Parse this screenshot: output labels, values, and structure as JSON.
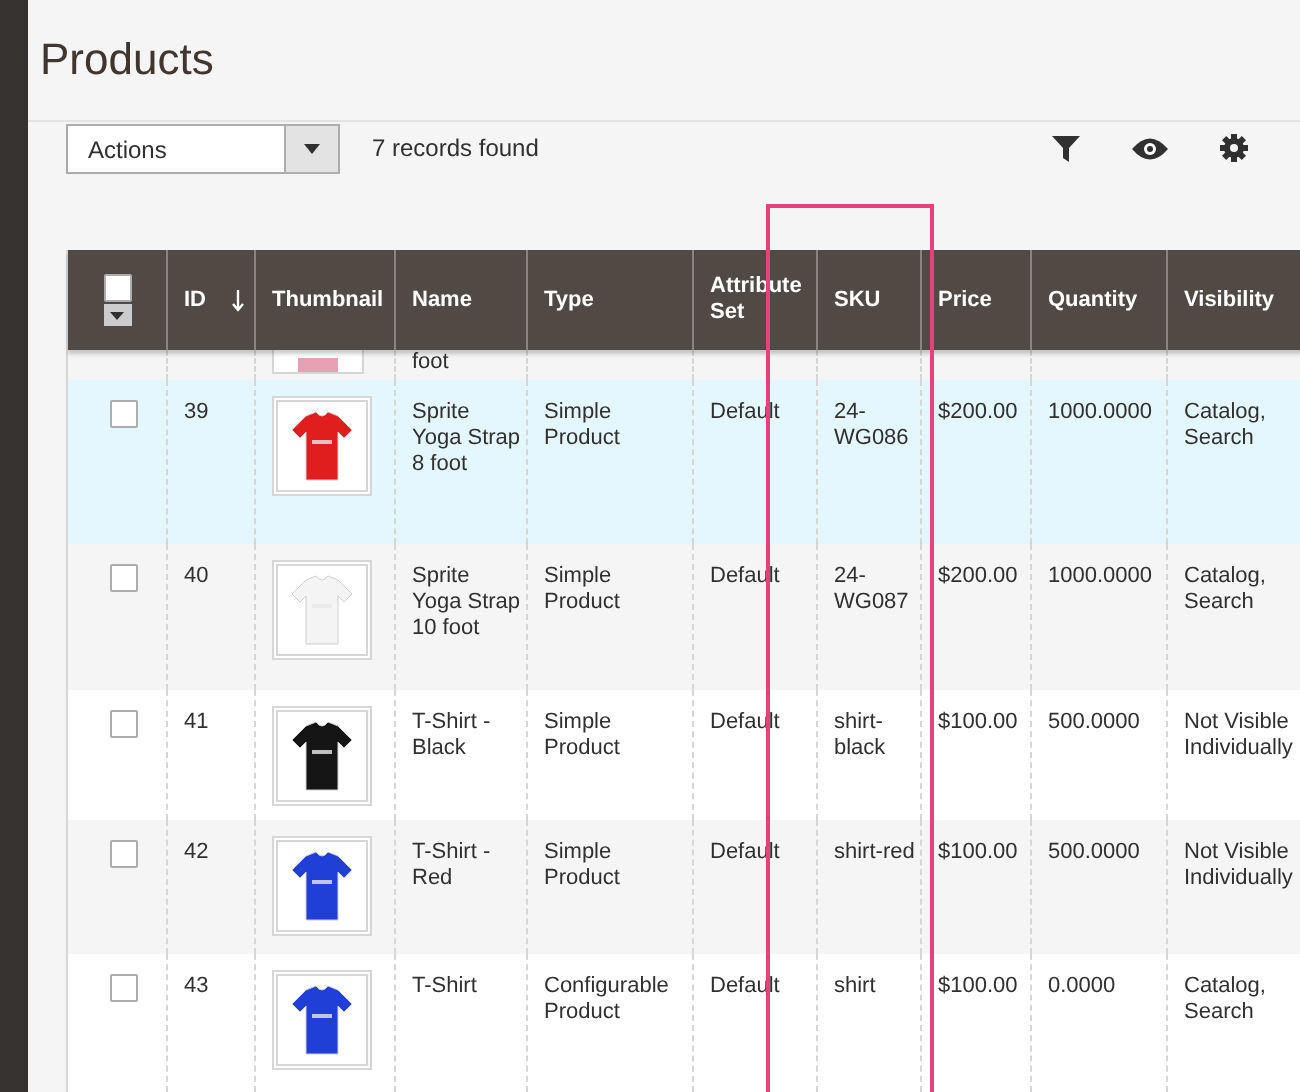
{
  "page": {
    "title": "Products"
  },
  "toolbar": {
    "actions": {
      "label": "Actions"
    },
    "records": "7 records found"
  },
  "table": {
    "select_all": {
      "checked": false
    },
    "columns": [
      {
        "label": "ID",
        "sorted": true
      },
      {
        "label": "Thumbnail",
        "sorted": false
      },
      {
        "label": "Name",
        "sorted": false
      },
      {
        "label": "Type",
        "sorted": false
      },
      {
        "label": "Attribute Set",
        "sorted": false
      },
      {
        "label": "SKU",
        "sorted": false
      },
      {
        "label": "Price",
        "sorted": false
      },
      {
        "label": "Quantity",
        "sorted": false
      },
      {
        "label": "Visibility",
        "sorted": false
      }
    ],
    "partial_row": {
      "name": "foot"
    },
    "rows": [
      {
        "checked": false,
        "highlighted": true,
        "id": "39",
        "name": "Sprite Yoga Strap 8 foot",
        "type": "Simple Product",
        "attribute_set": "Default",
        "sku": "24-WG086",
        "price": "$200.00",
        "quantity": "1000.0000",
        "visibility": "Catalog, Search"
      },
      {
        "checked": false,
        "highlighted": false,
        "id": "40",
        "name": "Sprite Yoga Strap 10 foot",
        "type": "Simple Product",
        "attribute_set": "Default",
        "sku": "24-WG087",
        "price": "$200.00",
        "quantity": "1000.0000",
        "visibility": "Catalog, Search"
      },
      {
        "checked": false,
        "highlighted": false,
        "id": "41",
        "name": "T-Shirt - Black",
        "type": "Simple Product",
        "attribute_set": "Default",
        "sku": "shirt-black",
        "price": "$100.00",
        "quantity": "500.0000",
        "visibility": "Not Visible Individually"
      },
      {
        "checked": false,
        "highlighted": false,
        "id": "42",
        "name": "T-Shirt - Red",
        "type": "Simple Product",
        "attribute_set": "Default",
        "sku": "shirt-red",
        "price": "$100.00",
        "quantity": "500.0000",
        "visibility": "Not Visible Individually"
      },
      {
        "checked": false,
        "highlighted": false,
        "id": "43",
        "name": "T-Shirt",
        "type": "Configurable Product",
        "attribute_set": "Default",
        "sku": "shirt",
        "price": "$100.00",
        "quantity": "0.0000",
        "visibility": "Catalog, Search"
      }
    ]
  }
}
